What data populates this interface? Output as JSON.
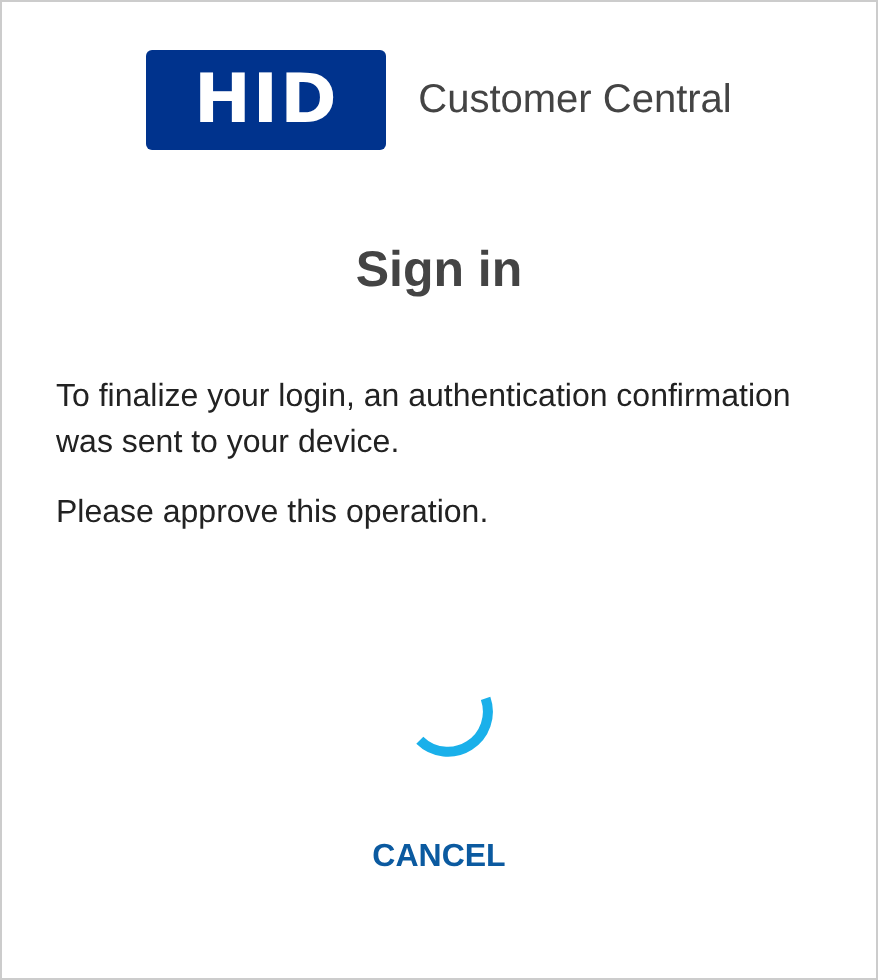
{
  "brand": {
    "logo_text": "HID",
    "product": "Customer Central"
  },
  "title": "Sign in",
  "messages": [
    "To finalize your login, an authentication confirmation was sent to your device.",
    "Please approve this operation."
  ],
  "cancel_button": "CANCEL"
}
